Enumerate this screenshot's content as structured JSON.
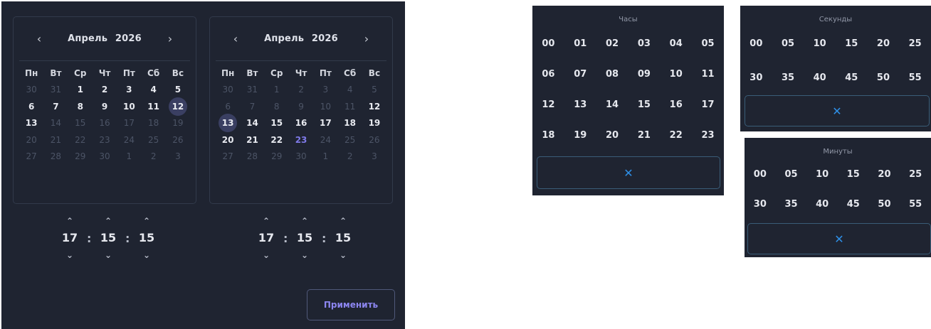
{
  "calendars": [
    {
      "prev_icon": "‹",
      "next_icon": "›",
      "month": "Апрель",
      "year": "2026",
      "weekdays": [
        "Пн",
        "Вт",
        "Ср",
        "Чт",
        "Пт",
        "Сб",
        "Вс"
      ],
      "days": [
        {
          "t": "30",
          "m": true
        },
        {
          "t": "31",
          "m": true
        },
        {
          "t": "1"
        },
        {
          "t": "2"
        },
        {
          "t": "3"
        },
        {
          "t": "4"
        },
        {
          "t": "5"
        },
        {
          "t": "6"
        },
        {
          "t": "7"
        },
        {
          "t": "8"
        },
        {
          "t": "9"
        },
        {
          "t": "10"
        },
        {
          "t": "11"
        },
        {
          "t": "12",
          "sel": true
        },
        {
          "t": "13"
        },
        {
          "t": "14",
          "m": true
        },
        {
          "t": "15",
          "m": true
        },
        {
          "t": "16",
          "m": true
        },
        {
          "t": "17",
          "m": true
        },
        {
          "t": "18",
          "m": true
        },
        {
          "t": "19",
          "m": true
        },
        {
          "t": "20",
          "m": true
        },
        {
          "t": "21",
          "m": true
        },
        {
          "t": "22",
          "m": true
        },
        {
          "t": "23",
          "m": true
        },
        {
          "t": "24",
          "m": true
        },
        {
          "t": "25",
          "m": true
        },
        {
          "t": "26",
          "m": true
        },
        {
          "t": "27",
          "m": true
        },
        {
          "t": "28",
          "m": true
        },
        {
          "t": "29",
          "m": true
        },
        {
          "t": "30",
          "m": true
        },
        {
          "t": "1",
          "m": true
        },
        {
          "t": "2",
          "m": true
        },
        {
          "t": "3",
          "m": true
        }
      ],
      "time": {
        "h": "17",
        "m": "15",
        "s": "15"
      }
    },
    {
      "prev_icon": "‹",
      "next_icon": "›",
      "month": "Апрель",
      "year": "2026",
      "weekdays": [
        "Пн",
        "Вт",
        "Ср",
        "Чт",
        "Пт",
        "Сб",
        "Вс"
      ],
      "days": [
        {
          "t": "30",
          "m": true
        },
        {
          "t": "31",
          "m": true
        },
        {
          "t": "1",
          "m": true
        },
        {
          "t": "2",
          "m": true
        },
        {
          "t": "3",
          "m": true
        },
        {
          "t": "4",
          "m": true
        },
        {
          "t": "5",
          "m": true
        },
        {
          "t": "6",
          "m": true
        },
        {
          "t": "7",
          "m": true
        },
        {
          "t": "8",
          "m": true
        },
        {
          "t": "9",
          "m": true
        },
        {
          "t": "10",
          "m": true
        },
        {
          "t": "11",
          "m": true
        },
        {
          "t": "12"
        },
        {
          "t": "13",
          "sel": true
        },
        {
          "t": "14"
        },
        {
          "t": "15"
        },
        {
          "t": "16"
        },
        {
          "t": "17"
        },
        {
          "t": "18"
        },
        {
          "t": "19"
        },
        {
          "t": "20"
        },
        {
          "t": "21"
        },
        {
          "t": "22"
        },
        {
          "t": "23",
          "today": true
        },
        {
          "t": "24",
          "m": true
        },
        {
          "t": "25",
          "m": true
        },
        {
          "t": "26",
          "m": true
        },
        {
          "t": "27",
          "m": true
        },
        {
          "t": "28",
          "m": true
        },
        {
          "t": "29",
          "m": true
        },
        {
          "t": "30",
          "m": true
        },
        {
          "t": "1",
          "m": true
        },
        {
          "t": "2",
          "m": true
        },
        {
          "t": "3",
          "m": true
        }
      ],
      "time": {
        "h": "17",
        "m": "15",
        "s": "15"
      }
    }
  ],
  "time_separator": ":",
  "up_icon": "⌃",
  "down_icon": "⌄",
  "apply_label": "Применить",
  "clear_icon": "✕",
  "hours_panel": {
    "title": "Часы",
    "rows": [
      [
        "00",
        "01",
        "02",
        "03",
        "04",
        "05"
      ],
      [
        "06",
        "07",
        "08",
        "09",
        "10",
        "11"
      ],
      [
        "12",
        "13",
        "14",
        "15",
        "16",
        "17"
      ],
      [
        "18",
        "19",
        "20",
        "21",
        "22",
        "23"
      ]
    ]
  },
  "seconds_panel": {
    "title": "Секунды",
    "rows": [
      [
        "00",
        "05",
        "10",
        "15",
        "20",
        "25"
      ],
      [
        "30",
        "35",
        "40",
        "45",
        "50",
        "55"
      ]
    ]
  },
  "minutes_panel": {
    "title": "Минуты",
    "rows": [
      [
        "00",
        "05",
        "10",
        "15",
        "20",
        "25"
      ],
      [
        "30",
        "35",
        "40",
        "45",
        "50",
        "55"
      ]
    ]
  },
  "colors": {
    "panel_bg": "#1f2431",
    "border": "#323a4b",
    "selected_bg": "#3a3f62",
    "accent": "#7f7ae8",
    "clear_blue": "#2e8fe6"
  }
}
